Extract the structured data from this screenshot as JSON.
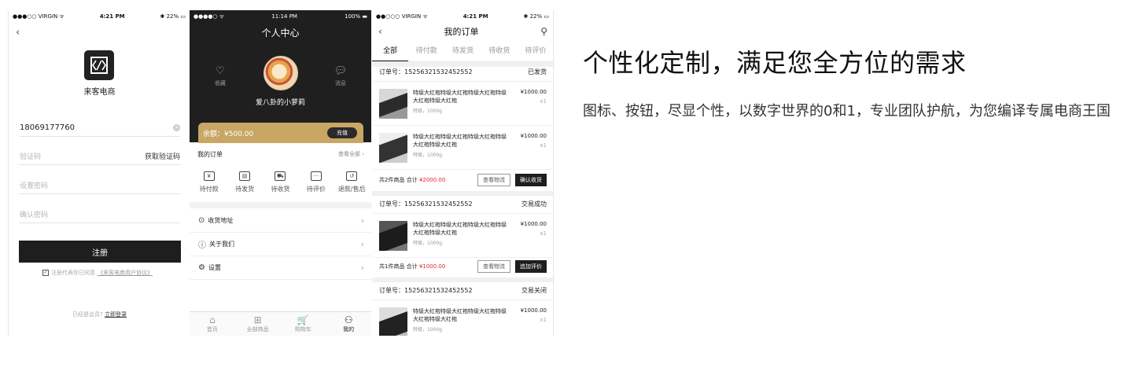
{
  "register": {
    "status": {
      "carrier": "●●●○○ VIRGIN ᯤ",
      "time": "4:21 PM",
      "battery": "✱ 22% ▭"
    },
    "brand": "来客电商",
    "phone_value": "18069177760",
    "code_placeholder": "验证码",
    "get_code": "获取验证码",
    "password_placeholder": "设置密码",
    "confirm_placeholder": "确认密码",
    "register_button": "注册",
    "agree_text": "注册代表你已同意",
    "agree_link": "《来客电商用户协议》",
    "login_prompt": "已经是会员?",
    "login_link": "立即登录"
  },
  "profile": {
    "status": {
      "carrier": "●●●●○ ᯤ",
      "time": "11:14 PM",
      "battery": "100% ▬"
    },
    "title": "个人中心",
    "favorites": "收藏",
    "messages": "消息",
    "username": "爱八卦的小萝莉",
    "balance_label": "余额：",
    "balance_value": "¥500.00",
    "recharge": "充值",
    "my_orders": "我的订单",
    "view_all": "查看全部",
    "order_types": [
      {
        "label": "待付款",
        "icon": "¥"
      },
      {
        "label": "待发货",
        "icon": "▤"
      },
      {
        "label": "待收货",
        "icon": "⛟"
      },
      {
        "label": "待评价",
        "icon": "···"
      },
      {
        "label": "退款/售后",
        "icon": "↺"
      }
    ],
    "menu": [
      {
        "label": "收货地址",
        "icon": "⊙"
      },
      {
        "label": "关于我们",
        "icon": "ⓘ"
      },
      {
        "label": "设置",
        "icon": "⚙"
      }
    ],
    "tabs": [
      {
        "label": "首页",
        "icon": "⌂"
      },
      {
        "label": "全部商品",
        "icon": "⊞"
      },
      {
        "label": "购物车",
        "icon": "🛒"
      },
      {
        "label": "我的",
        "icon": "⚇"
      }
    ]
  },
  "orders": {
    "status": {
      "carrier": "●●○○○ VIRGIN ᯤ",
      "time": "4:21 PM",
      "battery": "✱ 22% ▭"
    },
    "title": "我的订单",
    "tabs": [
      "全部",
      "待付款",
      "待发货",
      "待收货",
      "待评价"
    ],
    "order_no_label": "订单号：",
    "groups": [
      {
        "no": "15256321532452552",
        "state": "已发货",
        "items": [
          {
            "name": "特级大红袍特级大红袍特级大红袍特级大红袍特级大红袍",
            "spec": "特级，1000g",
            "price": "¥1000.00",
            "qty": "x1"
          },
          {
            "name": "特级大红袍特级大红袍特级大红袍特级大红袍特级大红袍",
            "spec": "特级，1000g",
            "price": "¥1000.00",
            "qty": "x1"
          }
        ],
        "count": "共2件商品",
        "total_label": "合计",
        "total": "¥2000.00",
        "btn1": "查看物流",
        "btn2": "确认收货"
      },
      {
        "no": "15256321532452552",
        "state": "交易成功",
        "items": [
          {
            "name": "特级大红袍特级大红袍特级大红袍特级大红袍特级大红袍",
            "spec": "特级，1000g",
            "price": "¥1000.00",
            "qty": "x1"
          }
        ],
        "count": "共1件商品",
        "total_label": "合计",
        "total": "¥1000.00",
        "btn1": "查看物流",
        "btn2": "追加评价"
      },
      {
        "no": "15256321532452552",
        "state": "交易关闭",
        "items": [
          {
            "name": "特级大红袍特级大红袍特级大红袍特级大红袍特级大红袍",
            "spec": "特级，1000g",
            "price": "¥1000.00",
            "qty": "x1"
          }
        ]
      }
    ]
  },
  "copy": {
    "title": "个性化定制，满足您全方位的需求",
    "body": "图标、按钮，尽显个性，以数字世界的0和1，专业团队护航，为您编译专属电商王国"
  },
  "colors": {
    "dark": "#1f1f1f",
    "gold": "#c8a664",
    "price_red": "#e0262f"
  }
}
